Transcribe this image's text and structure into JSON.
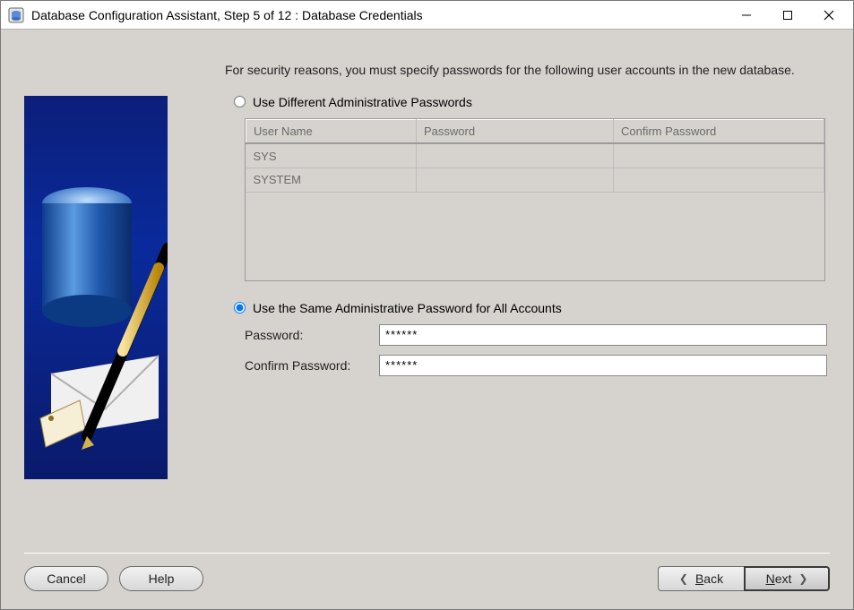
{
  "window": {
    "title": "Database Configuration Assistant, Step 5 of 12 : Database Credentials"
  },
  "content": {
    "intro": "For security reasons, you must specify passwords for the following user accounts in the new database.",
    "option_diff_label": "Use Different Administrative Passwords",
    "option_same_label": "Use the Same Administrative Password for All Accounts",
    "selected_option": "same",
    "table": {
      "headers": {
        "user": "User Name",
        "password": "Password",
        "confirm": "Confirm Password"
      },
      "rows": [
        {
          "user": "SYS",
          "password": "",
          "confirm": ""
        },
        {
          "user": "SYSTEM",
          "password": "",
          "confirm": ""
        }
      ]
    },
    "password_label": "Password:",
    "confirm_label": "Confirm Password:",
    "password_value": "******",
    "confirm_value": "******"
  },
  "buttons": {
    "cancel": "Cancel",
    "help": "Help",
    "back": "Back",
    "next": "Next",
    "back_underline": "B",
    "next_underline": "N"
  }
}
